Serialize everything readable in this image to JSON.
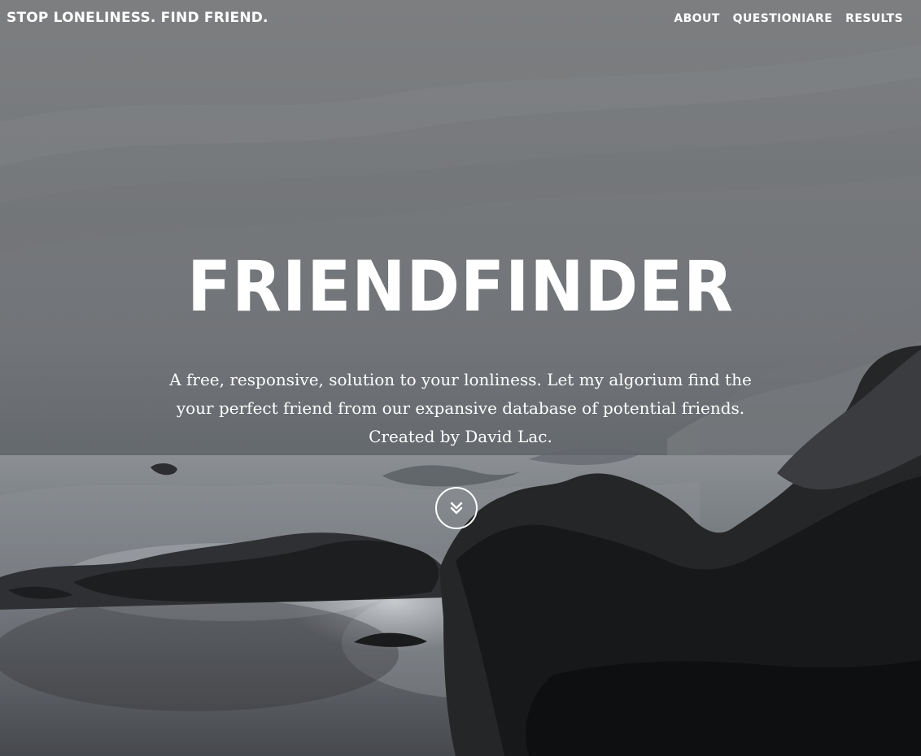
{
  "navbar": {
    "brand": "STOP LONELINESS. FIND FRIEND.",
    "links": [
      {
        "label": "ABOUT"
      },
      {
        "label": "QUESTIONIARE"
      },
      {
        "label": "RESULTS"
      }
    ]
  },
  "hero": {
    "title": "FRIENDFINDER",
    "intro_line1": "A free, responsive, solution to your lonliness. Let my algorium find the",
    "intro_line2": "your perfect friend from our expansive database of potential friends.",
    "intro_line3": "Created by David Lac.",
    "scroll_icon": "double-chevron-down-icon"
  },
  "colors": {
    "text": "#ffffff",
    "background_top": "#7a7c7e",
    "background_bottom": "#141517"
  }
}
